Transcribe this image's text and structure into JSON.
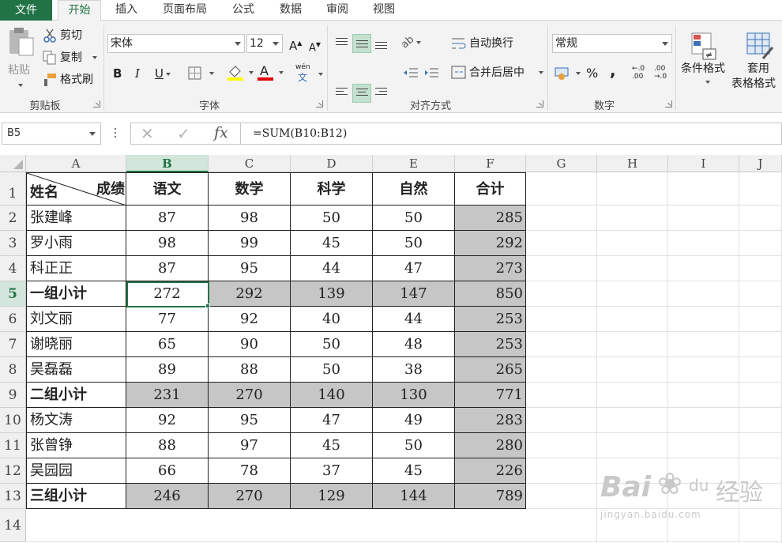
{
  "tabs": [
    "文件",
    "开始",
    "插入",
    "页面布局",
    "公式",
    "数据",
    "审阅",
    "视图"
  ],
  "clipboard": {
    "paste": "粘贴",
    "cut": "剪切",
    "copy": "复制",
    "format_painter": "格式刷",
    "label": "剪贴板"
  },
  "font": {
    "name": "宋体",
    "size": "12",
    "bold": "B",
    "italic": "I",
    "underline": "U",
    "phonetic": "wén",
    "font_color_glyph": "A",
    "grow": "A",
    "shrink": "A",
    "label": "字体",
    "highlight_color": "#ffff00",
    "font_color": "#e00000"
  },
  "alignment": {
    "wrap": "自动换行",
    "merge": "合并后居中",
    "label": "对齐方式"
  },
  "number": {
    "format": "常规",
    "percent": "%",
    "comma": ",",
    "inc_decimal_a": "←.0",
    "inc_decimal_b": ".00",
    "dec_decimal_a": ".00",
    "dec_decimal_b": "→.0",
    "label": "数字"
  },
  "styles": {
    "conditional": "条件格式",
    "table_a": "套用",
    "table_b": "表格格式"
  },
  "formula_bar": {
    "name_box": "B5",
    "formula": "=SUM(B10:B12)",
    "fx": "fx"
  },
  "columns": [
    "A",
    "B",
    "C",
    "D",
    "E",
    "F",
    "G",
    "H",
    "I",
    "J"
  ],
  "rows": [
    "1",
    "2",
    "3",
    "4",
    "5",
    "6",
    "7",
    "8",
    "9",
    "10",
    "11",
    "12",
    "13",
    "14"
  ],
  "header": {
    "name": "姓名",
    "score": "成绩",
    "c1": "语文",
    "c2": "数学",
    "c3": "科学",
    "c4": "自然",
    "total": "合计"
  },
  "table": [
    {
      "name": "张建峰",
      "v": [
        "87",
        "98",
        "50",
        "50"
      ],
      "total": "285",
      "subtotal": false
    },
    {
      "name": "罗小雨",
      "v": [
        "98",
        "99",
        "45",
        "50"
      ],
      "total": "292",
      "subtotal": false
    },
    {
      "name": "科正正",
      "v": [
        "87",
        "95",
        "44",
        "47"
      ],
      "total": "273",
      "subtotal": false
    },
    {
      "name": "一组小计",
      "v": [
        "272",
        "292",
        "139",
        "147"
      ],
      "total": "850",
      "subtotal": true
    },
    {
      "name": "刘文丽",
      "v": [
        "77",
        "92",
        "40",
        "44"
      ],
      "total": "253",
      "subtotal": false
    },
    {
      "name": "谢晓丽",
      "v": [
        "65",
        "90",
        "50",
        "48"
      ],
      "total": "253",
      "subtotal": false
    },
    {
      "name": "吴磊磊",
      "v": [
        "89",
        "88",
        "50",
        "38"
      ],
      "total": "265",
      "subtotal": false
    },
    {
      "name": "二组小计",
      "v": [
        "231",
        "270",
        "140",
        "130"
      ],
      "total": "771",
      "subtotal": true
    },
    {
      "name": "杨文涛",
      "v": [
        "92",
        "95",
        "47",
        "49"
      ],
      "total": "283",
      "subtotal": false
    },
    {
      "name": "张曾铮",
      "v": [
        "88",
        "97",
        "45",
        "50"
      ],
      "total": "280",
      "subtotal": false
    },
    {
      "name": "吴园园",
      "v": [
        "66",
        "78",
        "37",
        "45"
      ],
      "total": "226",
      "subtotal": false
    },
    {
      "name": "三组小计",
      "v": [
        "246",
        "270",
        "129",
        "144"
      ],
      "total": "789",
      "subtotal": true
    }
  ],
  "watermark": {
    "brand": "Bai",
    "du": "du",
    "jingyan": "经验",
    "url": "jingyan.baidu.com"
  }
}
